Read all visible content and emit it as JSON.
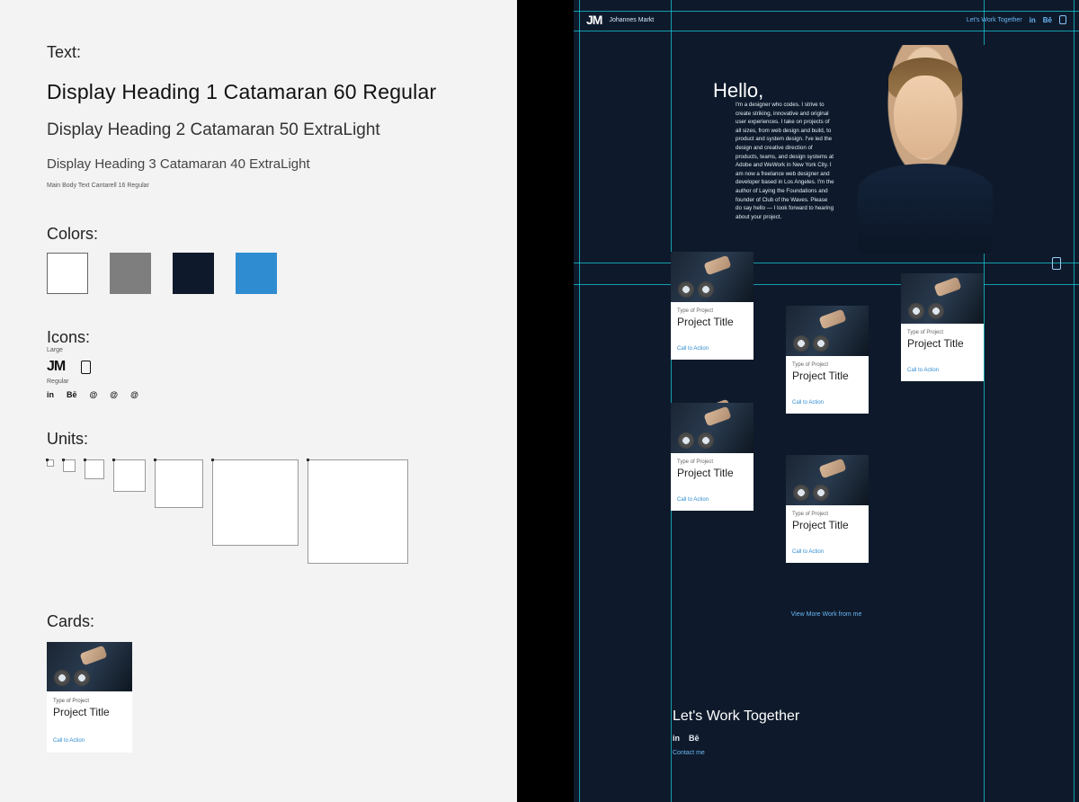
{
  "styleguide": {
    "text_label": "Text:",
    "h1": "Display Heading 1 Catamaran 60 Regular",
    "h2": "Display Heading 2 Catamaran 50 ExtraLight",
    "h3": "Display Heading 3 Catamaran 40 ExtraLight",
    "body": "Main Body Text Cantarell 16 Regular",
    "colors_label": "Colors:",
    "colors": {
      "white": "#ffffff",
      "gray": "#7e7e7e",
      "navy": "#0e1a2b",
      "blue": "#2f8cd0"
    },
    "icons_label": "Icons:",
    "icons_large_label": "Large",
    "icons_regular_label": "Regular",
    "logo_text": "JM",
    "reg_icons": {
      "linkedin": "in",
      "behance": "Bē",
      "at1": "@",
      "at2": "@",
      "at3": "@"
    },
    "units_label": "Units:",
    "cards_label": "Cards:",
    "card": {
      "type": "Type of Project",
      "title": "Project Title",
      "cta": "Call to Action"
    }
  },
  "site": {
    "nav": {
      "logo": "JM",
      "name": "Johannes Markt",
      "cta": "Let's Work Together",
      "linkedin": "in",
      "behance": "Bē"
    },
    "hero": {
      "hello": "Hello,",
      "bio": "I'm a designer who codes. I strive to create striking, innovative and original user experiences. I take on projects of all sizes, from web design and build, to product and system design. I've led the design and creative direction of products, teams, and design systems at Adobe and WeWork in New York City. I am now a freelance web designer and developer based in Los Angeles. I'm the author of Laying the Foundations and founder of Club of the Waves. Please do say hello — I look forward to hearing about your project."
    },
    "projects": {
      "type": "Type of Project",
      "title": "Project Title",
      "cta": "Call to Action",
      "more": "View More Work from me"
    },
    "footer": {
      "heading": "Let's Work Together",
      "linkedin": "in",
      "behance": "Bē",
      "contact": "Contact me"
    }
  }
}
